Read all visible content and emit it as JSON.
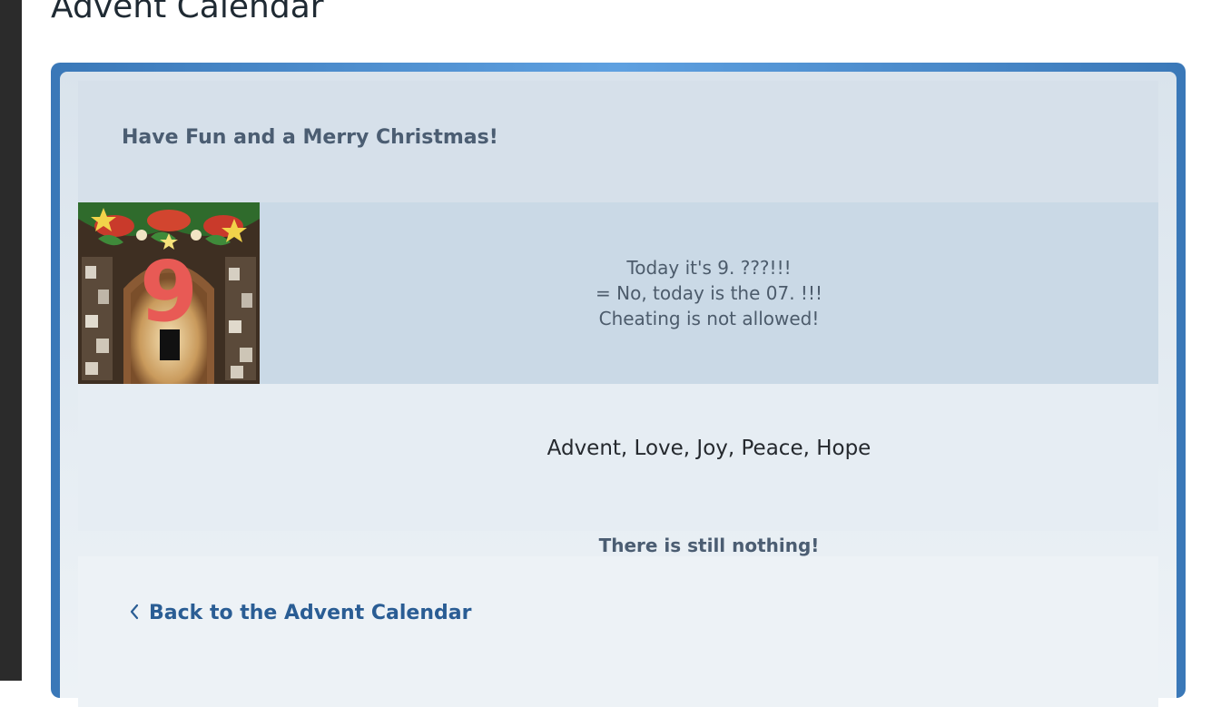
{
  "page": {
    "title": "Advent Calendar"
  },
  "calendar": {
    "greeting": "Have Fun and a Merry Christmas!",
    "door": {
      "number": "9",
      "image_alt": "advent-door-image",
      "message_lines": [
        "Today it's 9. ???!!!",
        "= No, today is the 07. !!!",
        "Cheating is not allowed!"
      ]
    },
    "words": "Advent, Love, Joy, Peace, Hope",
    "nothing": "There is still nothing!",
    "back_link": {
      "label": "Back to the Advent Calendar",
      "icon": "chevron-left-icon"
    }
  },
  "colors": {
    "frame": "#4a8ed0",
    "link": "#2a5d94",
    "door_number": "#e85a55"
  }
}
